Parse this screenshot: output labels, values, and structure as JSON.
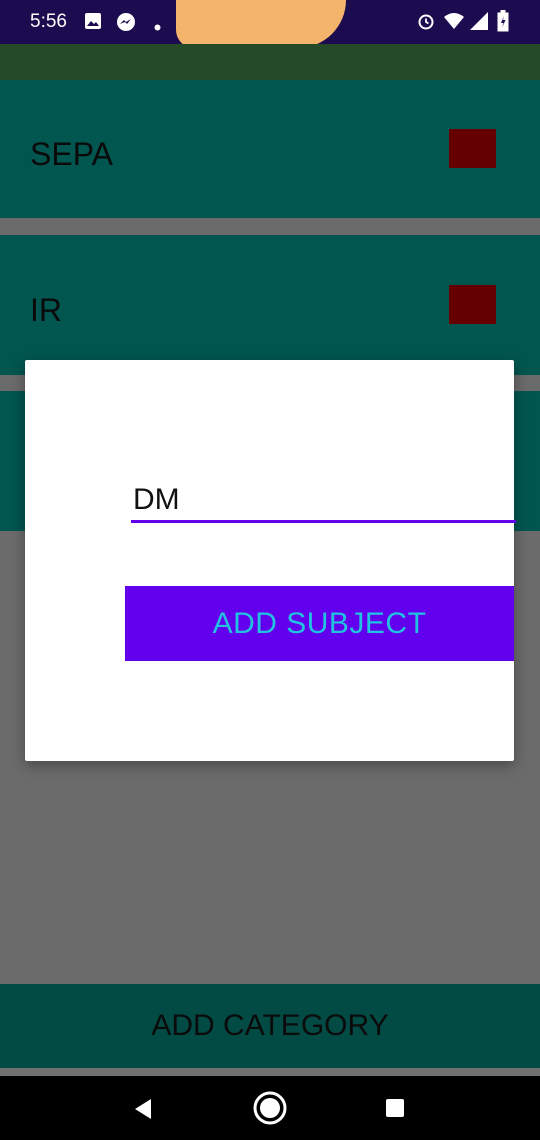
{
  "status_bar": {
    "time": "5:56",
    "left_icons": [
      "image-icon",
      "messenger-icon",
      "dot-icon"
    ],
    "right_icons": [
      "alarm-icon",
      "wifi-icon",
      "signal-icon",
      "battery-icon"
    ]
  },
  "categories": [
    {
      "label": "SEPA",
      "color": "#650000"
    },
    {
      "label": "IR",
      "color": "#650000"
    }
  ],
  "dialog": {
    "input_value": "DM",
    "button_label": "ADD SUBJECT"
  },
  "add_category_label": "ADD CATEGORY",
  "colors": {
    "status_bar": "#1c0b4e",
    "card": "#025650",
    "accent": "#6200ee",
    "button_text": "#21c3e0",
    "scrim": "#6b6b6b"
  }
}
